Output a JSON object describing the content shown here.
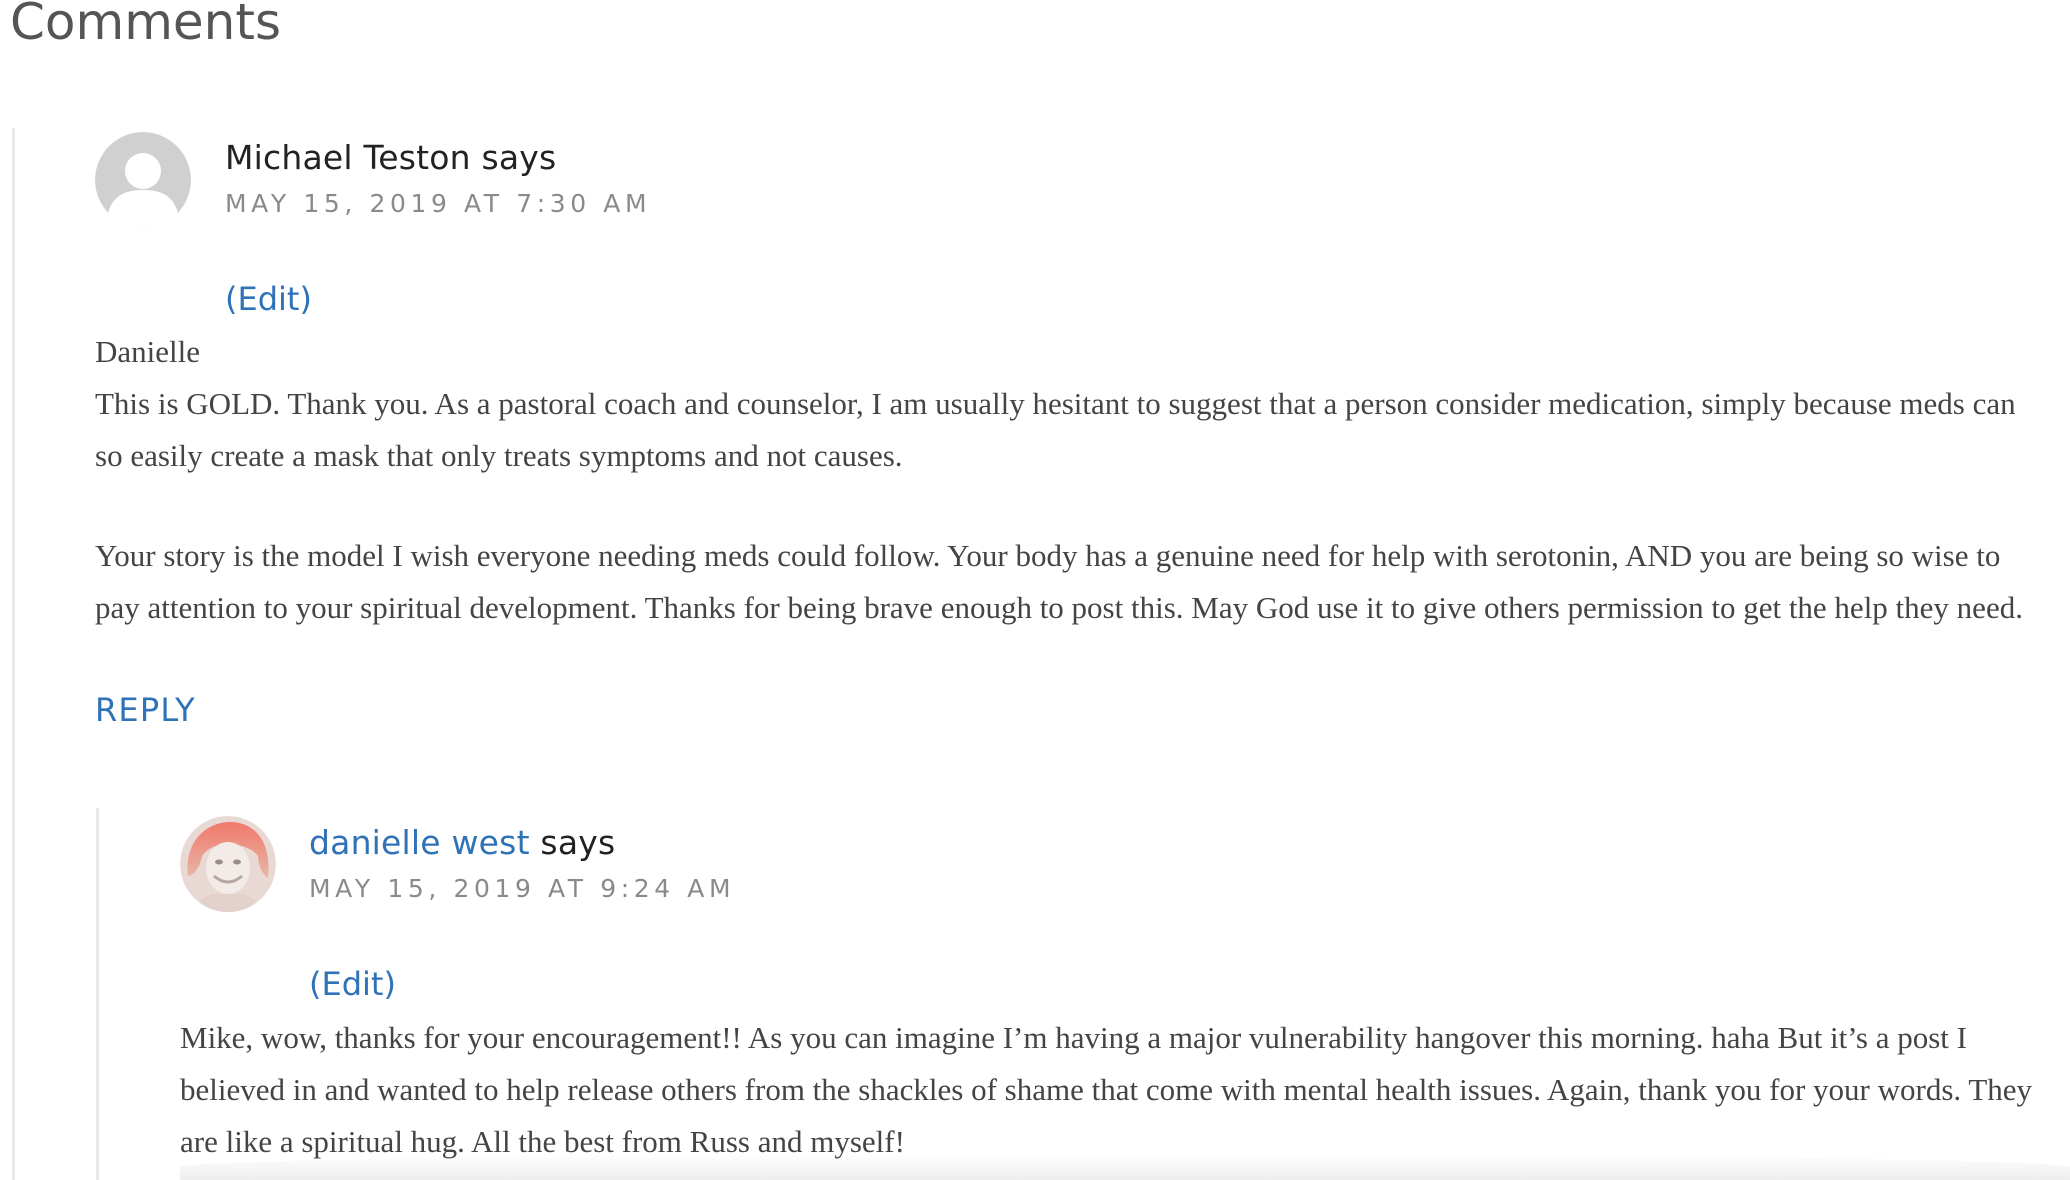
{
  "section": {
    "title": "Comments"
  },
  "comments": [
    {
      "author": "Michael Teston",
      "says": "says",
      "date": "MAY 15, 2019 AT 7:30 AM",
      "edit_label": "(Edit)",
      "body": {
        "line1": "Danielle",
        "line2": "This is GOLD. Thank you. As a pastoral coach and counselor, I am usually hesitant to suggest that a person consider medication, simply because meds can so easily create a mask that only treats symptoms and not causes.",
        "paragraph2": "Your story is the model I wish everyone needing meds could follow. Your body has a genuine need for help with serotonin, AND you are being so wise to pay attention to your spiritual development. Thanks for being brave enough to post this. May God use it to give others permission to get the help they need."
      },
      "reply_label": "REPLY",
      "avatar": "default-avatar-icon"
    },
    {
      "author": "danielle west",
      "says": "says",
      "date": "MAY 15, 2019 AT 9:24 AM",
      "edit_label": "(Edit)",
      "body": {
        "paragraph1": "Mike, wow, thanks for your encouragement!! As you can imagine I’m having a major vulnerability hangover this morning. haha But it’s a post I believed in and wanted to help release others from the shackles of shame that come with mental health issues. Again, thank you for your words. They are like a spiritual hug. All the best from Russ and myself!"
      },
      "avatar": "user-photo-avatar"
    }
  ],
  "colors": {
    "link": "#2f72b8",
    "date": "#8a8a8a",
    "body_text": "#444444",
    "title": "#555555"
  }
}
